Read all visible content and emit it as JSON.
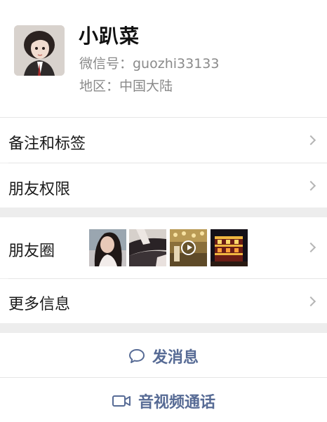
{
  "profile": {
    "name": "小趴菜",
    "wechat_id": "微信号：guozhi33133",
    "region": "地区：中国大陆",
    "avatar_icon": "profile-photo"
  },
  "menu": {
    "remarks_tags": "备注和标签",
    "friend_permissions": "朋友权限",
    "moments": "朋友圈",
    "more_info": "更多信息"
  },
  "moments_thumbnails": [
    {
      "icon": "photo-portrait"
    },
    {
      "icon": "photo-legs"
    },
    {
      "icon": "video-thumbnail"
    },
    {
      "icon": "photo-night-building"
    }
  ],
  "actions": {
    "send_message": "发消息",
    "video_call": "音视频通话"
  },
  "colors": {
    "link_blue": "#576b95",
    "background": "#ededed",
    "secondary_text": "#8a8a8a"
  }
}
